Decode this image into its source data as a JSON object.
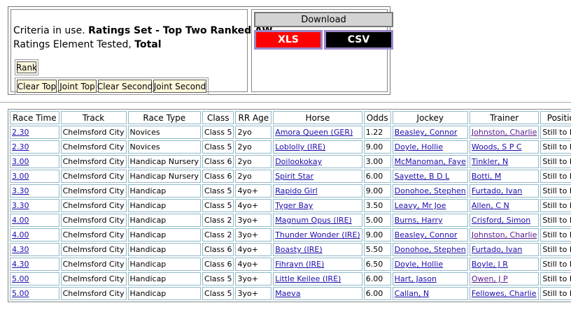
{
  "criteria": {
    "prefix": "Criteria in use.",
    "ratings_set": "Ratings Set - Top Two Ranked AW",
    "element_prefix": "Ratings Element Tested,",
    "element_value": "Total"
  },
  "buttons": {
    "rank": "Rank",
    "clear_top": "Clear Top",
    "joint_top": "Joint Top",
    "clear_second": "Clear Second",
    "joint_second": "Joint Second"
  },
  "download": {
    "title": "Download",
    "xls": "XLS",
    "csv": "CSV",
    "xls_color": "#ff0000",
    "csv_color": "#000000"
  },
  "table": {
    "headers": [
      "Race Time",
      "Track",
      "Race Type",
      "Class",
      "RR Age",
      "Horse",
      "Odds",
      "Jockey",
      "Trainer",
      "Position"
    ],
    "rows": [
      {
        "time": "2.30",
        "track": "Chelmsford City",
        "type": "Novices",
        "class": "Class 5",
        "age": "2yo",
        "horse": "Amora Queen (GER)",
        "odds": "1.22",
        "jockey": "Beasley, Connor",
        "trainer": "Johnston, Charlie",
        "position": "Still to Run"
      },
      {
        "time": "2.30",
        "track": "Chelmsford City",
        "type": "Novices",
        "class": "Class 5",
        "age": "2yo",
        "horse": "Loblolly (IRE)",
        "odds": "9.00",
        "jockey": "Doyle, Hollie",
        "trainer": "Woods, S P C",
        "position": "Still to Run"
      },
      {
        "time": "3.00",
        "track": "Chelmsford City",
        "type": "Handicap Nursery",
        "class": "Class 6",
        "age": "2yo",
        "horse": "Doilookokay",
        "odds": "3.00",
        "jockey": "McManoman, Faye",
        "trainer": "Tinkler, N",
        "position": "Still to Run"
      },
      {
        "time": "3.00",
        "track": "Chelmsford City",
        "type": "Handicap Nursery",
        "class": "Class 6",
        "age": "2yo",
        "horse": "Spirit Star",
        "odds": "6.00",
        "jockey": "Sayette, B D L",
        "trainer": "Botti, M",
        "position": "Still to Run"
      },
      {
        "time": "3.30",
        "track": "Chelmsford City",
        "type": "Handicap",
        "class": "Class 5",
        "age": "4yo+",
        "horse": "Rapido Girl",
        "odds": "9.00",
        "jockey": "Donohoe, Stephen",
        "trainer": "Furtado, Ivan",
        "position": "Still to Run"
      },
      {
        "time": "3.30",
        "track": "Chelmsford City",
        "type": "Handicap",
        "class": "Class 5",
        "age": "4yo+",
        "horse": "Tyger Bay",
        "odds": "3.50",
        "jockey": "Leavy, Mr Joe",
        "trainer": "Allen, C N",
        "position": "Still to Run"
      },
      {
        "time": "4.00",
        "track": "Chelmsford City",
        "type": "Handicap",
        "class": "Class 2",
        "age": "3yo+",
        "horse": "Magnum Opus (IRE)",
        "odds": "5.00",
        "jockey": "Burns, Harry",
        "trainer": "Crisford, Simon",
        "position": "Still to Run"
      },
      {
        "time": "4.00",
        "track": "Chelmsford City",
        "type": "Handicap",
        "class": "Class 2",
        "age": "3yo+",
        "horse": "Thunder Wonder (IRE)",
        "odds": "9.00",
        "jockey": "Beasley, Connor",
        "trainer": "Johnston, Charlie",
        "position": "Still to Run"
      },
      {
        "time": "4.30",
        "track": "Chelmsford City",
        "type": "Handicap",
        "class": "Class 6",
        "age": "4yo+",
        "horse": "Boasty (IRE)",
        "odds": "5.50",
        "jockey": "Donohoe, Stephen",
        "trainer": "Furtado, Ivan",
        "position": "Still to Run"
      },
      {
        "time": "4.30",
        "track": "Chelmsford City",
        "type": "Handicap",
        "class": "Class 6",
        "age": "4yo+",
        "horse": "Fihrayn (IRE)",
        "odds": "6.50",
        "jockey": "Doyle, Hollie",
        "trainer": "Boyle, J R",
        "position": "Still to Run"
      },
      {
        "time": "5.00",
        "track": "Chelmsford City",
        "type": "Handicap",
        "class": "Class 5",
        "age": "3yo+",
        "horse": "Little Keilee (IRE)",
        "odds": "6.00",
        "jockey": "Hart, Jason",
        "trainer": "Owen, J P",
        "position": "Still to Run"
      },
      {
        "time": "5.00",
        "track": "Chelmsford City",
        "type": "Handicap",
        "class": "Class 5",
        "age": "3yo+",
        "horse": "Maeva",
        "odds": "6.00",
        "jockey": "Callan, N",
        "trainer": "Fellowes, Charlie",
        "position": "Still to Run"
      }
    ]
  }
}
